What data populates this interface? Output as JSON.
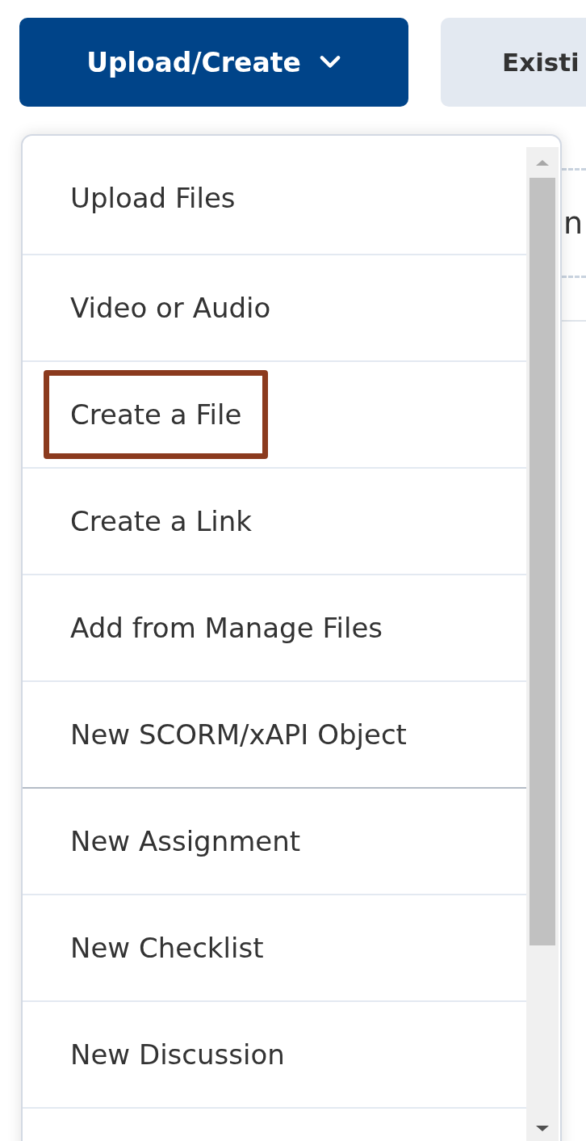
{
  "toolbar": {
    "primary_button": {
      "label": "Upload/Create",
      "expanded": true
    },
    "secondary_button": {
      "label": "Existi"
    }
  },
  "background_text": "n",
  "menu": {
    "items": [
      {
        "label": "Upload Files",
        "highlighted": false,
        "separator_above": false
      },
      {
        "label": "Video or Audio",
        "highlighted": false,
        "separator_above": false
      },
      {
        "label": "Create a File",
        "highlighted": true,
        "separator_above": false
      },
      {
        "label": "Create a Link",
        "highlighted": false,
        "separator_above": false
      },
      {
        "label": "Add from Manage Files",
        "highlighted": false,
        "separator_above": false
      },
      {
        "label": "New SCORM/xAPI Object",
        "highlighted": false,
        "separator_above": false
      },
      {
        "label": "New Assignment",
        "highlighted": false,
        "separator_above": true
      },
      {
        "label": "New Checklist",
        "highlighted": false,
        "separator_above": false
      },
      {
        "label": "New Discussion",
        "highlighted": false,
        "separator_above": false
      }
    ]
  }
}
